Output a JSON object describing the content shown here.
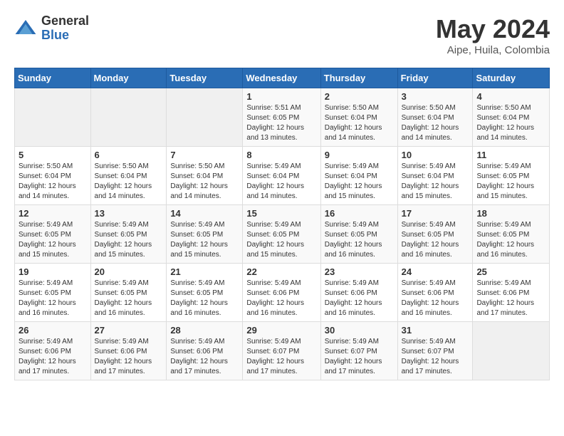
{
  "header": {
    "logo_general": "General",
    "logo_blue": "Blue",
    "month_year": "May 2024",
    "location": "Aipe, Huila, Colombia"
  },
  "weekdays": [
    "Sunday",
    "Monday",
    "Tuesday",
    "Wednesday",
    "Thursday",
    "Friday",
    "Saturday"
  ],
  "weeks": [
    [
      {
        "day": "",
        "sunrise": "",
        "sunset": "",
        "daylight": ""
      },
      {
        "day": "",
        "sunrise": "",
        "sunset": "",
        "daylight": ""
      },
      {
        "day": "",
        "sunrise": "",
        "sunset": "",
        "daylight": ""
      },
      {
        "day": "1",
        "sunrise": "Sunrise: 5:51 AM",
        "sunset": "Sunset: 6:05 PM",
        "daylight": "Daylight: 12 hours and 13 minutes."
      },
      {
        "day": "2",
        "sunrise": "Sunrise: 5:50 AM",
        "sunset": "Sunset: 6:04 PM",
        "daylight": "Daylight: 12 hours and 14 minutes."
      },
      {
        "day": "3",
        "sunrise": "Sunrise: 5:50 AM",
        "sunset": "Sunset: 6:04 PM",
        "daylight": "Daylight: 12 hours and 14 minutes."
      },
      {
        "day": "4",
        "sunrise": "Sunrise: 5:50 AM",
        "sunset": "Sunset: 6:04 PM",
        "daylight": "Daylight: 12 hours and 14 minutes."
      }
    ],
    [
      {
        "day": "5",
        "sunrise": "Sunrise: 5:50 AM",
        "sunset": "Sunset: 6:04 PM",
        "daylight": "Daylight: 12 hours and 14 minutes."
      },
      {
        "day": "6",
        "sunrise": "Sunrise: 5:50 AM",
        "sunset": "Sunset: 6:04 PM",
        "daylight": "Daylight: 12 hours and 14 minutes."
      },
      {
        "day": "7",
        "sunrise": "Sunrise: 5:50 AM",
        "sunset": "Sunset: 6:04 PM",
        "daylight": "Daylight: 12 hours and 14 minutes."
      },
      {
        "day": "8",
        "sunrise": "Sunrise: 5:49 AM",
        "sunset": "Sunset: 6:04 PM",
        "daylight": "Daylight: 12 hours and 14 minutes."
      },
      {
        "day": "9",
        "sunrise": "Sunrise: 5:49 AM",
        "sunset": "Sunset: 6:04 PM",
        "daylight": "Daylight: 12 hours and 15 minutes."
      },
      {
        "day": "10",
        "sunrise": "Sunrise: 5:49 AM",
        "sunset": "Sunset: 6:04 PM",
        "daylight": "Daylight: 12 hours and 15 minutes."
      },
      {
        "day": "11",
        "sunrise": "Sunrise: 5:49 AM",
        "sunset": "Sunset: 6:05 PM",
        "daylight": "Daylight: 12 hours and 15 minutes."
      }
    ],
    [
      {
        "day": "12",
        "sunrise": "Sunrise: 5:49 AM",
        "sunset": "Sunset: 6:05 PM",
        "daylight": "Daylight: 12 hours and 15 minutes."
      },
      {
        "day": "13",
        "sunrise": "Sunrise: 5:49 AM",
        "sunset": "Sunset: 6:05 PM",
        "daylight": "Daylight: 12 hours and 15 minutes."
      },
      {
        "day": "14",
        "sunrise": "Sunrise: 5:49 AM",
        "sunset": "Sunset: 6:05 PM",
        "daylight": "Daylight: 12 hours and 15 minutes."
      },
      {
        "day": "15",
        "sunrise": "Sunrise: 5:49 AM",
        "sunset": "Sunset: 6:05 PM",
        "daylight": "Daylight: 12 hours and 15 minutes."
      },
      {
        "day": "16",
        "sunrise": "Sunrise: 5:49 AM",
        "sunset": "Sunset: 6:05 PM",
        "daylight": "Daylight: 12 hours and 16 minutes."
      },
      {
        "day": "17",
        "sunrise": "Sunrise: 5:49 AM",
        "sunset": "Sunset: 6:05 PM",
        "daylight": "Daylight: 12 hours and 16 minutes."
      },
      {
        "day": "18",
        "sunrise": "Sunrise: 5:49 AM",
        "sunset": "Sunset: 6:05 PM",
        "daylight": "Daylight: 12 hours and 16 minutes."
      }
    ],
    [
      {
        "day": "19",
        "sunrise": "Sunrise: 5:49 AM",
        "sunset": "Sunset: 6:05 PM",
        "daylight": "Daylight: 12 hours and 16 minutes."
      },
      {
        "day": "20",
        "sunrise": "Sunrise: 5:49 AM",
        "sunset": "Sunset: 6:05 PM",
        "daylight": "Daylight: 12 hours and 16 minutes."
      },
      {
        "day": "21",
        "sunrise": "Sunrise: 5:49 AM",
        "sunset": "Sunset: 6:05 PM",
        "daylight": "Daylight: 12 hours and 16 minutes."
      },
      {
        "day": "22",
        "sunrise": "Sunrise: 5:49 AM",
        "sunset": "Sunset: 6:06 PM",
        "daylight": "Daylight: 12 hours and 16 minutes."
      },
      {
        "day": "23",
        "sunrise": "Sunrise: 5:49 AM",
        "sunset": "Sunset: 6:06 PM",
        "daylight": "Daylight: 12 hours and 16 minutes."
      },
      {
        "day": "24",
        "sunrise": "Sunrise: 5:49 AM",
        "sunset": "Sunset: 6:06 PM",
        "daylight": "Daylight: 12 hours and 16 minutes."
      },
      {
        "day": "25",
        "sunrise": "Sunrise: 5:49 AM",
        "sunset": "Sunset: 6:06 PM",
        "daylight": "Daylight: 12 hours and 17 minutes."
      }
    ],
    [
      {
        "day": "26",
        "sunrise": "Sunrise: 5:49 AM",
        "sunset": "Sunset: 6:06 PM",
        "daylight": "Daylight: 12 hours and 17 minutes."
      },
      {
        "day": "27",
        "sunrise": "Sunrise: 5:49 AM",
        "sunset": "Sunset: 6:06 PM",
        "daylight": "Daylight: 12 hours and 17 minutes."
      },
      {
        "day": "28",
        "sunrise": "Sunrise: 5:49 AM",
        "sunset": "Sunset: 6:06 PM",
        "daylight": "Daylight: 12 hours and 17 minutes."
      },
      {
        "day": "29",
        "sunrise": "Sunrise: 5:49 AM",
        "sunset": "Sunset: 6:07 PM",
        "daylight": "Daylight: 12 hours and 17 minutes."
      },
      {
        "day": "30",
        "sunrise": "Sunrise: 5:49 AM",
        "sunset": "Sunset: 6:07 PM",
        "daylight": "Daylight: 12 hours and 17 minutes."
      },
      {
        "day": "31",
        "sunrise": "Sunrise: 5:49 AM",
        "sunset": "Sunset: 6:07 PM",
        "daylight": "Daylight: 12 hours and 17 minutes."
      },
      {
        "day": "",
        "sunrise": "",
        "sunset": "",
        "daylight": ""
      }
    ]
  ]
}
